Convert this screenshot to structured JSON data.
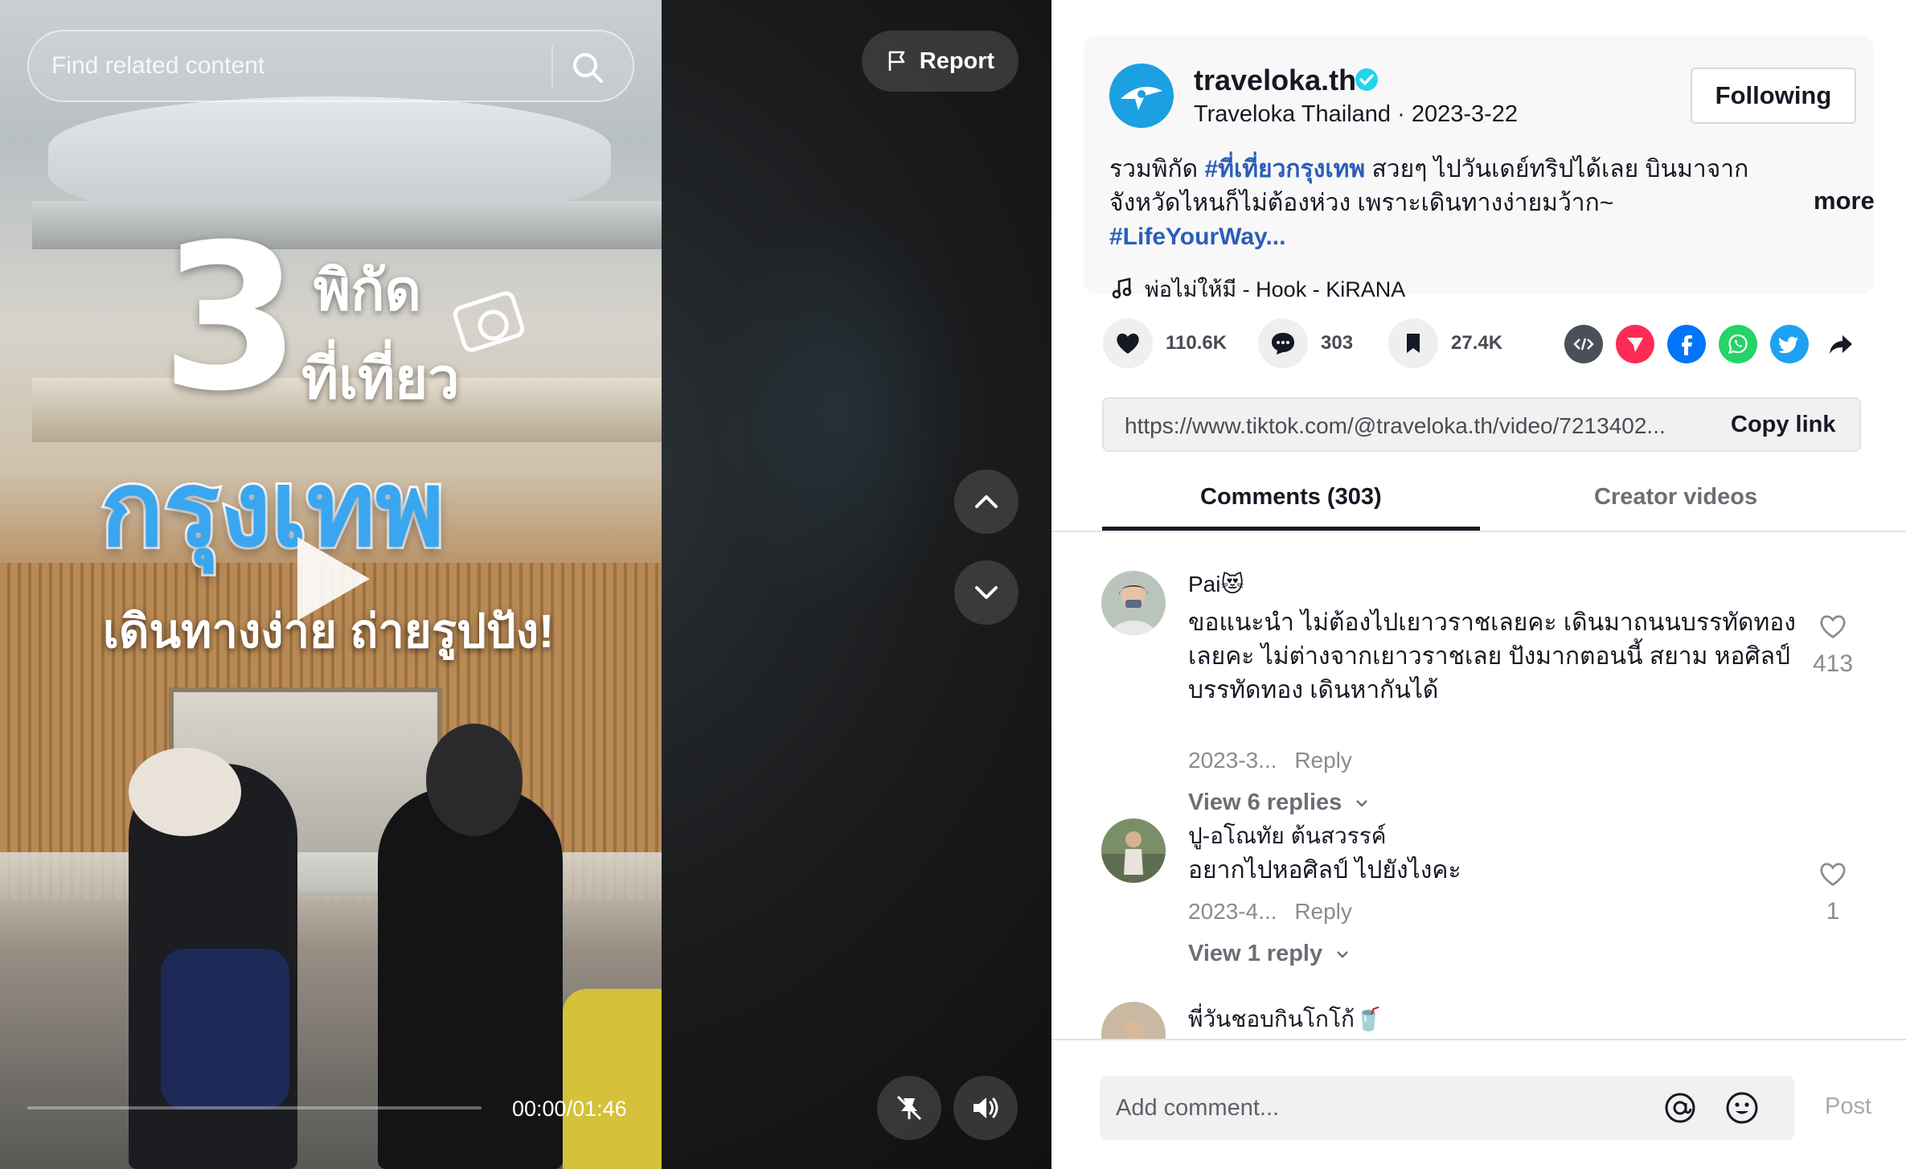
{
  "search": {
    "placeholder": "Find related content"
  },
  "video": {
    "overlay_number": "3",
    "overlay_line1": "พิกัด",
    "overlay_line2": "ที่เที่ยว",
    "overlay_city": "กรุงเทพ",
    "overlay_sub": "เดินทางง่าย ถ่ายรูปปัง!",
    "time": "00:00/01:46",
    "progress": 0.0
  },
  "controls": {
    "report_label": "Report"
  },
  "creator": {
    "handle": "traveloka.th",
    "name": "Traveloka Thailand",
    "date": "2023-3-22",
    "separator": " · ",
    "follow_label": "Following"
  },
  "caption": {
    "part1": "รวมพิกัด ",
    "hashtag1": "#ที่เที่ยวกรุงเทพ",
    "part2": " สวยๆ ไปวันเดย์ทริปได้เลย บินมาจากจังหวัดไหนก็ไม่ต้องห่วง เพราะเดินทางง่ายมว้าก~ ",
    "hashtag2": "#LifeYourWay...",
    "more": "more"
  },
  "music": {
    "title": "พ่อไม่ให้มี - Hook - KiRANA"
  },
  "stats": {
    "likes": "110.6K",
    "comments": "303",
    "bookmarks": "27.4K"
  },
  "share": {
    "link": "https://www.tiktok.com/@traveloka.th/video/7213402...",
    "copy_label": "Copy link"
  },
  "tabs": [
    {
      "label": "Comments (303)"
    },
    {
      "label": "Creator videos"
    }
  ],
  "comments": [
    {
      "name": "Pai😻",
      "text": "ขอแนะนำ ไม่ต้องไปเยาวราชเลยคะ เดินมาถนนบรรทัดทองเลยคะ ไม่ต่างจากเยาวราชเลย ปังมากตอนนี้ สยาม หอศิลป์ บรรทัดทอง เดินหากันได้",
      "date": "2023-3...",
      "reply": "Reply",
      "likes": "413",
      "view_replies": "View 6 replies"
    },
    {
      "name": "ปู-อโณทัย ต้นสวรรค์",
      "text": "อยากไปหอศิลป์ ไปยังไงคะ",
      "date": "2023-4...",
      "reply": "Reply",
      "likes": "1",
      "view_replies": "View 1 reply"
    },
    {
      "name": "พี่วันชอบกินโกโก้🥤"
    }
  ],
  "comment_bar": {
    "placeholder": "Add comment...",
    "post_label": "Post"
  },
  "colors": {
    "accent_red": "#fe2c55",
    "hashtag_blue": "#2b5db9",
    "verified_blue": "#20d5ec",
    "facebook": "#0075fa",
    "whatsapp": "#25d366",
    "twitter": "#1da1f2"
  }
}
